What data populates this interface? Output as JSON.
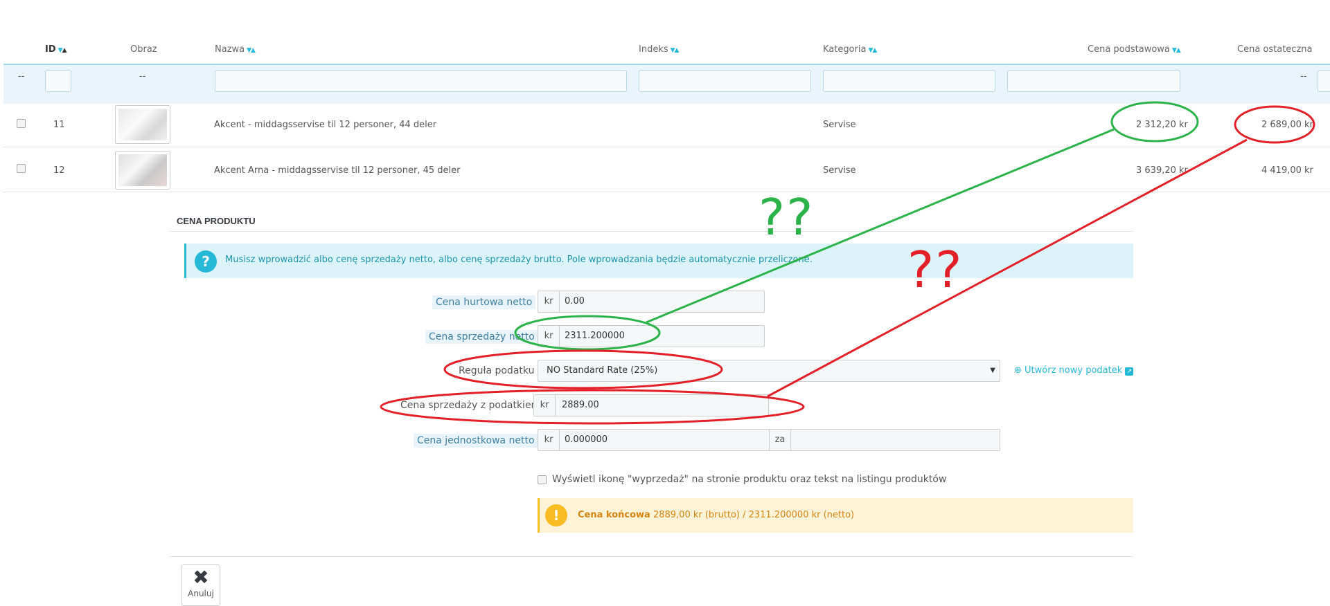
{
  "table": {
    "columns": {
      "id": "ID",
      "image": "Obraz",
      "name": "Nazwa",
      "reference": "Indeks",
      "category": "Kategoria",
      "base_price": "Cena podstawowa",
      "final_price": "Cena ostateczna"
    },
    "filter_placeholders": {
      "id": "--",
      "image": "--",
      "final_price": "--"
    },
    "rows": [
      {
        "id": "11",
        "name": "Akcent - middagsservise til 12 personer, 44 deler",
        "category": "Servise",
        "base_price": "2 312,20 kr",
        "final_price": "2 689,00 kr"
      },
      {
        "id": "12",
        "name": "Akcent Arna - middagsservise til 12 personer, 45 deler",
        "category": "Servise",
        "base_price": "3 639,20 kr",
        "final_price": "4 419,00 kr"
      }
    ]
  },
  "price_panel": {
    "title": "CENA PRODUKTU",
    "info_text": "Musisz wprowadzić albo cenę sprzedaży netto, albo cenę sprzedaży brutto. Pole wprowadzania będzie automatycznie przeliczone.",
    "currency": "kr",
    "wholesale_label": "Cena hurtowa netto",
    "wholesale_value": "0.00",
    "net_price_label": "Cena sprzedaży netto",
    "net_price_value": "2311.200000",
    "tax_rule_label": "Reguła podatku",
    "tax_rule_value": "NO Standard Rate (25%)",
    "create_tax_link": "Utwórz nowy podatek",
    "gross_price_label": "Cena sprzedaży z podatkiem",
    "gross_price_value": "2889.00",
    "unit_price_label": "Cena jednostkowa netto",
    "unit_price_value": "0.000000",
    "unit_per": "za",
    "sale_checkbox_label": "Wyświetl ikonę \"wyprzedaż\" na stronie produktu oraz tekst na listingu produktów",
    "final_price_bold": "Cena końcowa",
    "final_price_detail": "2889,00 kr (brutto) / 2311.200000 kr (netto)",
    "cancel_label": "Anuluj"
  },
  "annotations": {
    "green_marks": "??",
    "red_marks": "??",
    "green_color": "#2bb34a",
    "red_color": "#e32028"
  }
}
